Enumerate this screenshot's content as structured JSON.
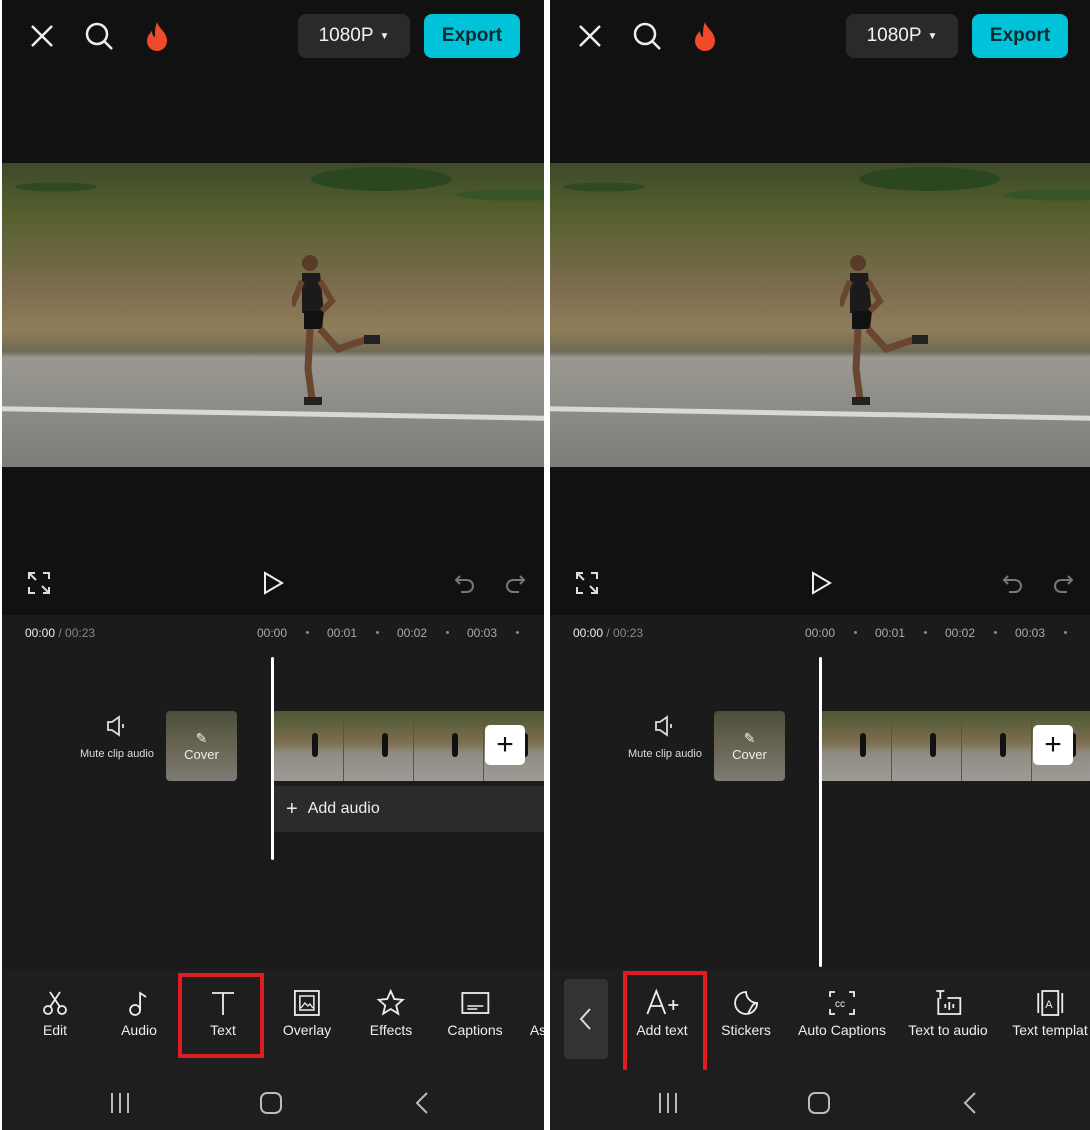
{
  "colors": {
    "accent": "#00c2d9",
    "highlight": "#e01b22",
    "background": "#111111"
  },
  "top_bar": {
    "close_icon": "close-icon",
    "search_icon": "search-icon",
    "flame_icon": "flame-icon",
    "resolution": "1080P",
    "export_label": "Export"
  },
  "timeline": {
    "current": "00:00",
    "total": "/ 00:23",
    "ticks": [
      "00:00",
      "00:01",
      "00:02",
      "00:03"
    ],
    "mute_label": "Mute clip audio",
    "cover_label": "Cover",
    "add_audio_label": "Add audio"
  },
  "left_panel": {
    "toolbar": [
      {
        "label": "Edit",
        "icon": "scissors-icon"
      },
      {
        "label": "Audio",
        "icon": "music-note-icon"
      },
      {
        "label": "Text",
        "icon": "text-icon",
        "highlighted": true
      },
      {
        "label": "Overlay",
        "icon": "overlay-icon"
      },
      {
        "label": "Effects",
        "icon": "effects-star-icon"
      },
      {
        "label": "Captions",
        "icon": "captions-icon"
      },
      {
        "label": "As",
        "icon": ""
      }
    ]
  },
  "right_panel": {
    "toolbar": [
      {
        "label": "Add text",
        "icon": "add-text-icon",
        "highlighted": true
      },
      {
        "label": "Stickers",
        "icon": "sticker-icon"
      },
      {
        "label": "Auto Captions",
        "icon": "auto-captions-icon"
      },
      {
        "label": "Text to audio",
        "icon": "text-to-audio-icon"
      },
      {
        "label": "Text templat",
        "icon": "text-template-icon"
      }
    ]
  }
}
